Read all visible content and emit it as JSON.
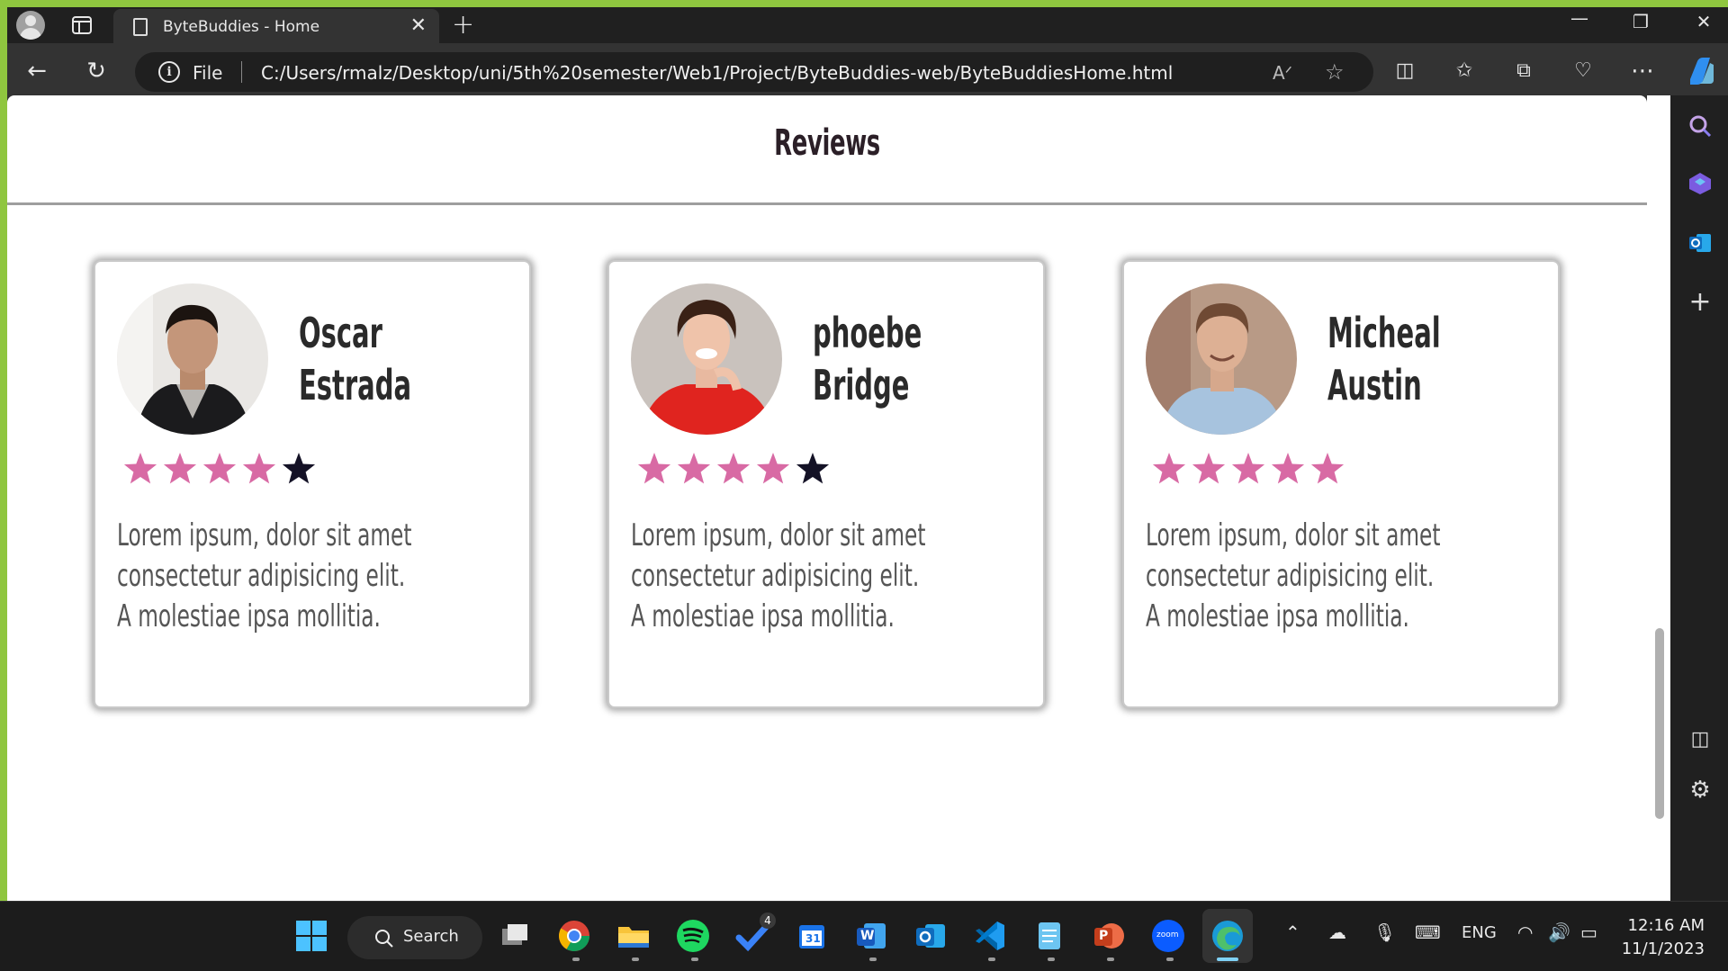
{
  "browser": {
    "tab_title": "ByteBuddies - Home",
    "address_scheme": "File",
    "address_url": "C:/Users/rmalz/Desktop/uni/5th%20semester/Web1/Project/ByteBuddies-web/ByteBuddiesHome.html"
  },
  "page": {
    "section_title": "Reviews",
    "accent_color": "#d06596",
    "reviews": [
      {
        "first": "Oscar",
        "last": "Estrada",
        "rating": 4,
        "max_rating": 5,
        "text_line1": "Lorem ipsum, dolor sit amet",
        "text_line2": "consectetur adipisicing elit.",
        "text_line3": "A molestiae ipsa mollitia."
      },
      {
        "first": "phoebe",
        "last": "Bridge",
        "rating": 4,
        "max_rating": 5,
        "text_line1": "Lorem ipsum, dolor sit amet",
        "text_line2": "consectetur adipisicing elit.",
        "text_line3": "A molestiae ipsa mollitia."
      },
      {
        "first": "Micheal",
        "last": "Austin",
        "rating": 5,
        "max_rating": 5,
        "text_line1": "Lorem ipsum, dolor sit amet",
        "text_line2": "consectetur adipisicing elit.",
        "text_line3": "A molestiae ipsa mollitia."
      }
    ],
    "star_filled_color": "#d86aa4",
    "star_empty_color": "#141226"
  },
  "taskbar": {
    "search_label": "Search",
    "todo_badge": "4",
    "calendar_day": "31",
    "word_letter": "W",
    "powerpoint_letter": "P",
    "zoom_label": "zoom",
    "language": "ENG",
    "time": "12:16 AM",
    "date": "11/1/2023"
  }
}
